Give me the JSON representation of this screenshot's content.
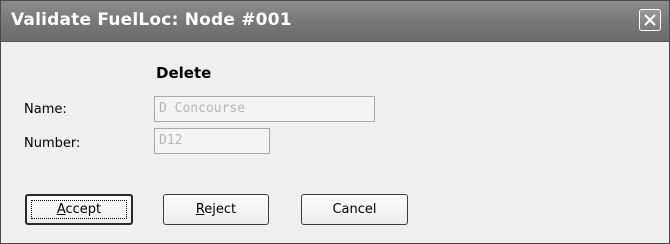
{
  "dialog": {
    "title": "Validate FuelLoc: Node #001",
    "heading": "Delete"
  },
  "fields": {
    "name": {
      "label": "Name:",
      "value": "D Concourse"
    },
    "number": {
      "label": "Number:",
      "value": "D12"
    }
  },
  "buttons": {
    "accept": {
      "mnemonic": "A",
      "rest": "ccept"
    },
    "reject": {
      "mnemonic": "R",
      "rest": "eject"
    },
    "cancel": {
      "label": "Cancel"
    }
  },
  "icons": {
    "close": "close-icon"
  }
}
